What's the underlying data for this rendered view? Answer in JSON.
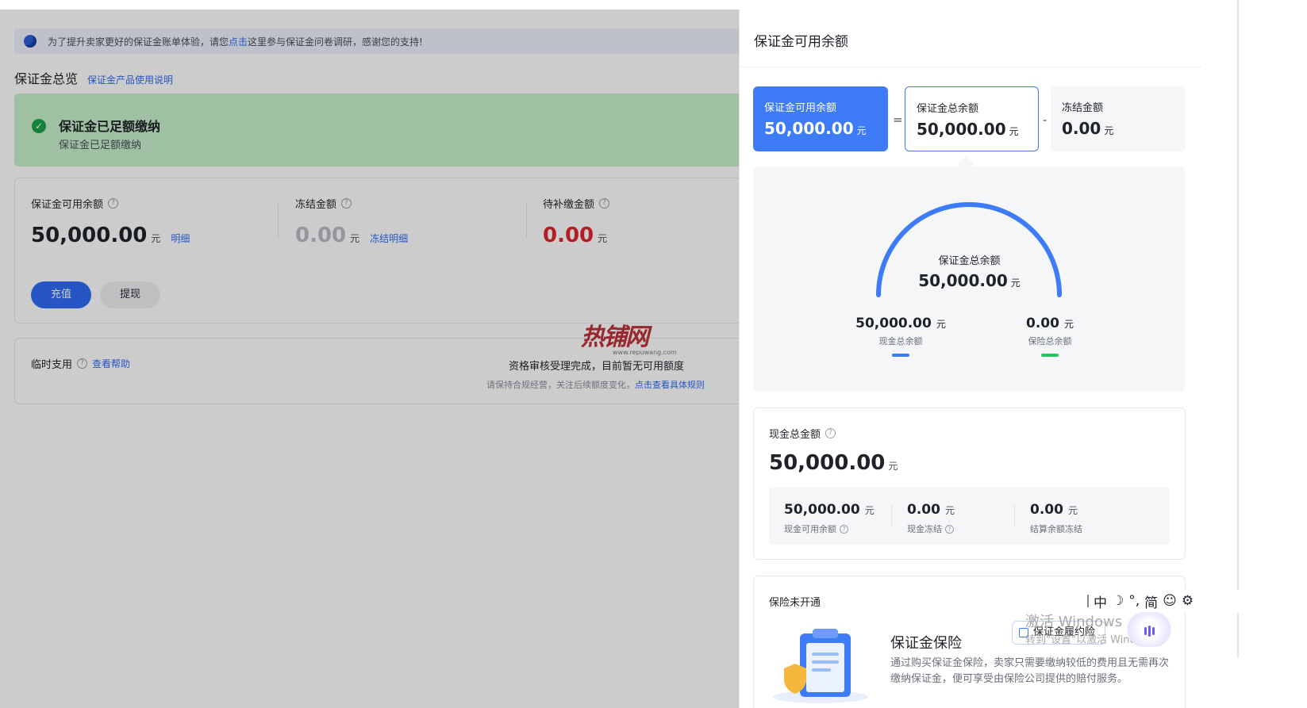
{
  "notice": {
    "text_before": "为了提升卖家更好的保证金账单体验，请您",
    "link": "点击",
    "text_after": "这里参与保证金问卷调研，感谢您的支持!"
  },
  "overview": {
    "title": "保证金总览",
    "link": "保证金产品使用说明"
  },
  "status": {
    "title": "保证金已足额缴纳",
    "subtitle": "保证金已足额缴纳"
  },
  "amounts": {
    "available": {
      "label": "保证金可用余额",
      "value": "50,000.00",
      "unit": "元",
      "link": "明细"
    },
    "frozen": {
      "label": "冻结金额",
      "value": "0.00",
      "unit": "元",
      "link": "冻结明细"
    },
    "pending": {
      "label": "待补缴金额",
      "value": "0.00",
      "unit": "元"
    },
    "recharge_button": "充值",
    "withdraw_button": "提现"
  },
  "temporary": {
    "label": "临时支用",
    "help_link": "查看帮助",
    "message": "资格审核受理完成，目前暂无可用额度",
    "sub_text": "请保持合规经营，关注后续额度变化，",
    "sub_link": "点击查看具体规则"
  },
  "watermark": {
    "text": "热铺网",
    "url": "www.repuwang.com"
  },
  "drawer": {
    "title": "保证金可用余额",
    "cards": {
      "available": {
        "label": "保证金可用余额",
        "value": "50,000.00",
        "unit": "元"
      },
      "total": {
        "label": "保证金总余额",
        "value": "50,000.00",
        "unit": "元"
      },
      "frozen": {
        "label": "冻结金额",
        "value": "0.00",
        "unit": "元"
      },
      "op_equals": "=",
      "op_minus": "-"
    },
    "gauge": {
      "center_label": "保证金总余额",
      "center_value": "50,000.00",
      "center_unit": "元",
      "cash": {
        "value": "50,000.00",
        "unit": "元",
        "label": "现金总余额",
        "color": "#3d7bf7"
      },
      "insurance": {
        "value": "0.00",
        "unit": "元",
        "label": "保险总余额",
        "color": "#22c55e"
      },
      "cash_fraction": 1.0
    },
    "cash": {
      "label": "现金总金额",
      "value": "50,000.00",
      "unit": "元",
      "items": [
        {
          "value": "50,000.00",
          "unit": "元",
          "label": "现金可用余额"
        },
        {
          "value": "0.00",
          "unit": "元",
          "label": "现金冻结"
        },
        {
          "value": "0.00",
          "unit": "元",
          "label": "结算余额冻结"
        }
      ]
    },
    "insurance": {
      "label": "保险未开通",
      "title": "保证金保险",
      "tag": "保证金履约险",
      "desc": "通过购买保证金保险，卖家只需要缴纳较低的费用且无需再次缴纳保证金，便可享受由保险公司提供的赔付服务。"
    }
  },
  "ime": {
    "items": [
      "中",
      "☽",
      "°,",
      "简",
      "☺",
      "⚙"
    ]
  },
  "windows": {
    "line1": "激活 Windows",
    "line2": "转到\"设置\"以激活 Windows。"
  },
  "colors": {
    "accent": "#3d7bf7",
    "danger": "#e0262f",
    "success": "#1aa34a"
  }
}
